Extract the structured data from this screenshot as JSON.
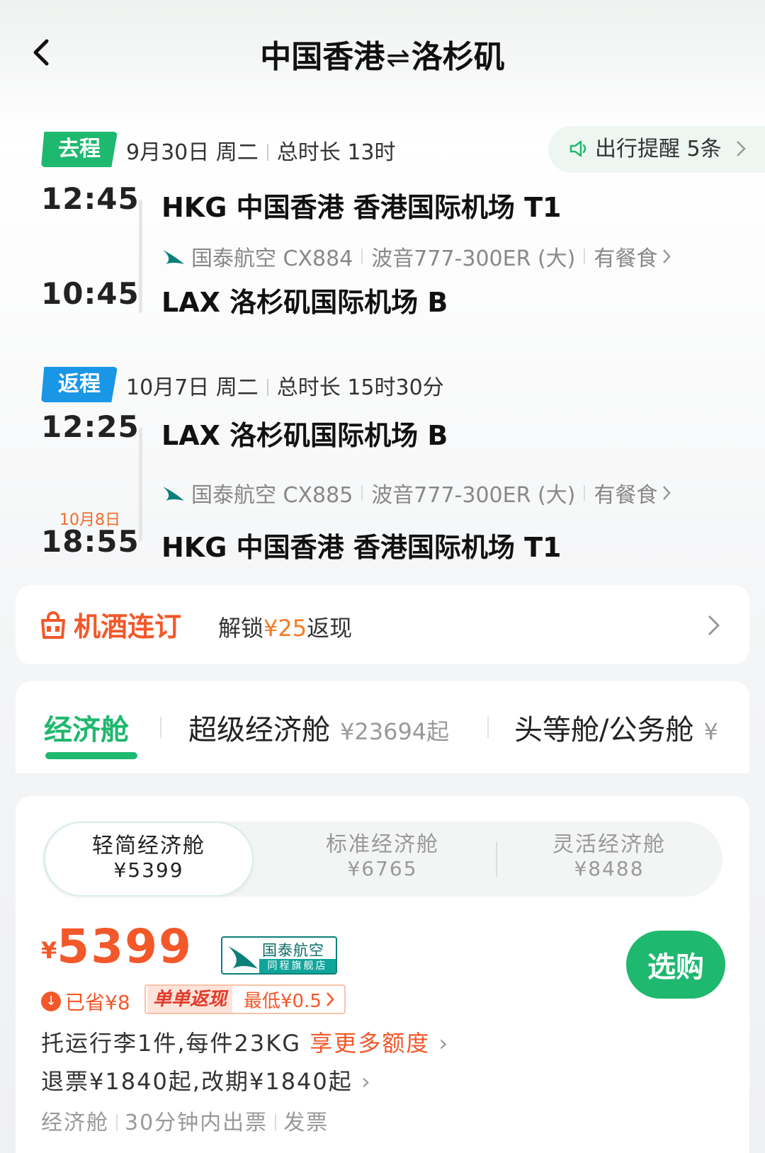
{
  "header": {
    "origin": "中国香港",
    "swap": "⇌",
    "destination": "洛杉矶"
  },
  "outbound": {
    "tag": "去程",
    "date": "9月30日 周二",
    "duration": "总时长 13时",
    "dep_time": "12:45",
    "dep_airport": "HKG 中国香港 香港国际机场 T1",
    "airline": "国泰航空 CX884",
    "aircraft": "波音777-300ER (大)",
    "meal": "有餐食",
    "arr_time": "10:45",
    "arr_airport": "LAX 洛杉矶国际机场 B"
  },
  "reminder": {
    "label": "出行提醒 5条"
  },
  "return": {
    "tag": "返程",
    "date": "10月7日 周二",
    "duration": "总时长 15时30分",
    "dep_time": "12:25",
    "dep_airport": "LAX 洛杉矶国际机场 B",
    "airline": "国泰航空 CX885",
    "aircraft": "波音777-300ER (大)",
    "meal": "有餐食",
    "arr_date": "10月8日",
    "arr_time": "18:55",
    "arr_airport": "HKG 中国香港 香港国际机场 T1"
  },
  "hotel_bundle": {
    "brand": "机酒连订",
    "text_prefix": "解锁",
    "amount": "¥25",
    "text_suffix": "返现"
  },
  "cabins": [
    {
      "label": "经济舱",
      "price": ""
    },
    {
      "label": "超级经济舱",
      "price": "¥23694起"
    },
    {
      "label": "头等舱/公务舱",
      "price": "¥"
    }
  ],
  "fares": [
    {
      "label": "轻简经济舱",
      "price": "¥5399"
    },
    {
      "label": "标准经济舱",
      "price": "¥6765"
    },
    {
      "label": "灵活经济舱",
      "price": "¥8488"
    }
  ],
  "selected_fare": {
    "currency": "¥",
    "price": "5399",
    "airline_name": "国泰航空",
    "store_label": "同程旗舰店",
    "buy_label": "选购",
    "saved": "已省¥8",
    "promo_tag": "单单返现",
    "promo_text": "最低¥0.5",
    "baggage": "托运行李1件,每件23KG",
    "baggage_more": "享更多额度",
    "refund": "退票¥1840起,改期¥1840起",
    "cabin_class": "经济舱",
    "ticketing": "30分钟内出票",
    "invoice": "发票"
  },
  "colors": {
    "brand_green": "#1fb86f",
    "return_blue": "#1a96e6",
    "price_orange": "#f2582a"
  }
}
